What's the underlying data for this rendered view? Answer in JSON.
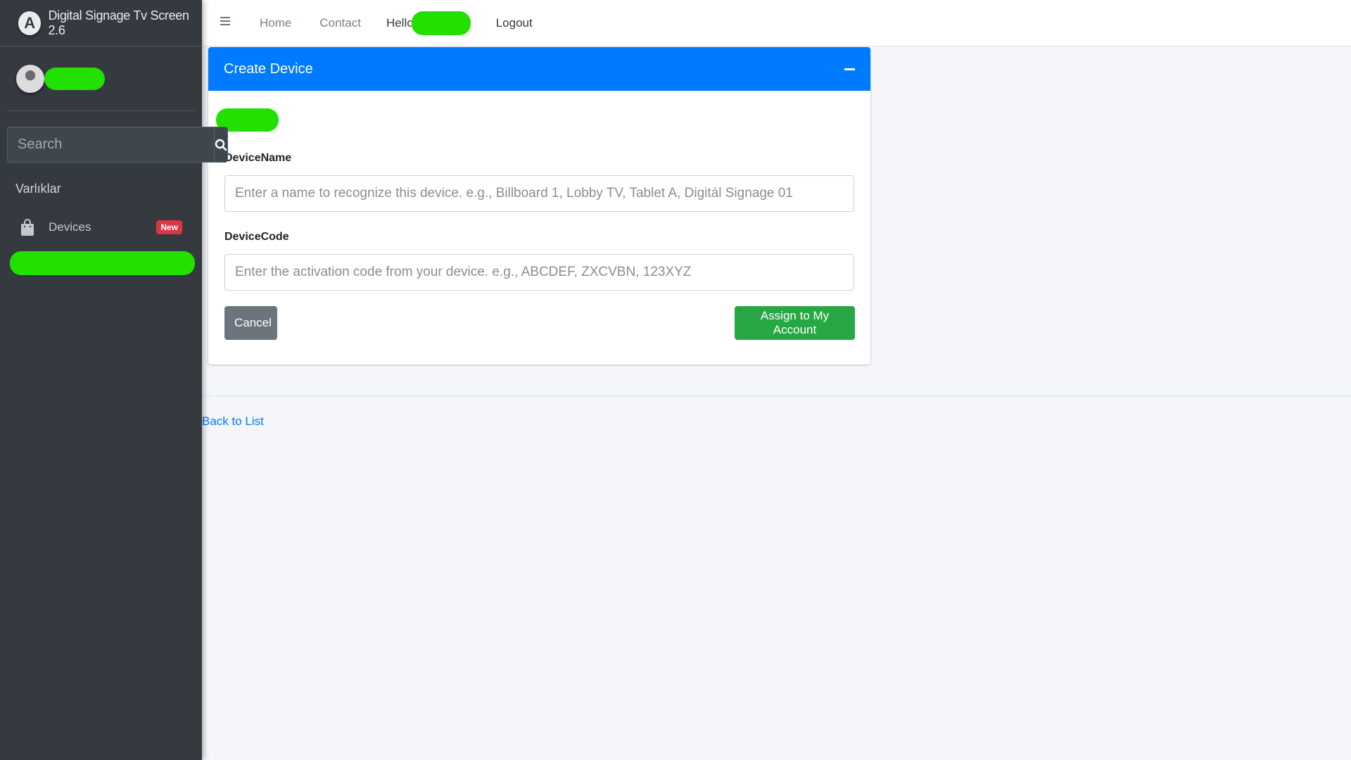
{
  "brand": {
    "logo_letter": "A",
    "title": "Digital Signage Tv Screen 2.6"
  },
  "sidebar": {
    "search_placeholder": "Search",
    "section_header": "Varlıklar",
    "items": [
      {
        "label": "Devices",
        "icon": "shopping-bag-icon",
        "badge": "New"
      }
    ]
  },
  "topnav": {
    "menu_icon": "hamburger-icon",
    "links": [
      "Home",
      "Contact"
    ],
    "greeting": "Hello",
    "logout": "Logout"
  },
  "card": {
    "title": "Create Device",
    "fields": [
      {
        "label": "DeviceName",
        "placeholder": "Enter a name to recognize this device. e.g., Billboard 1, Lobby TV, Tablet A, Digitál Signage 01",
        "value": ""
      },
      {
        "label": "DeviceCode",
        "placeholder": "Enter the activation code from your device. e.g., ABCDEF, ZXCVBN, 123XYZ",
        "value": ""
      }
    ],
    "cancel_label": "Cancel",
    "submit_label": "Assign to My Account"
  },
  "footer": {
    "back_link": "Back to List"
  },
  "colors": {
    "sidebar_bg": "#343a40",
    "primary": "#007bff",
    "success": "#28a745",
    "secondary": "#6c757d",
    "badge_danger": "#dc3545",
    "redaction": "#22e000"
  }
}
